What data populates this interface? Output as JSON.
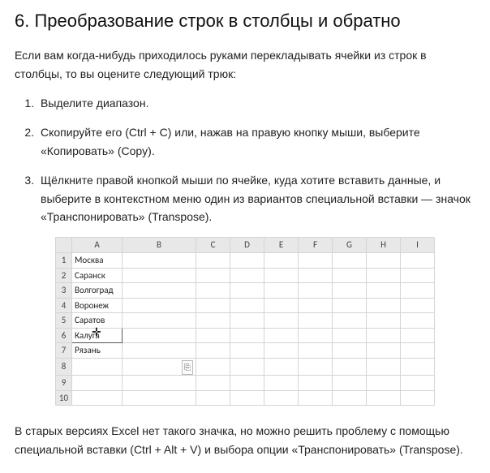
{
  "heading": "6. Преобразование строк в столбцы и обратно",
  "intro": "Если вам когда-нибудь приходилось руками перекладывать ячейки из строк в столбцы, то вы оцените следующий трюк:",
  "steps": {
    "s1": "Выделите диапазон.",
    "s2": "Скопируйте его (Ctrl + C) или, нажав на правую кнопку мыши, выберите «Копировать» (Copy).",
    "s3": "Щёлкните правой кнопкой мыши по ячейке, куда хотите вставить данные, и выберите в контекстном меню один из вариантов специальной вставки — значок «Транспонировать» (Transpose)."
  },
  "excel": {
    "cols": [
      "A",
      "B",
      "C",
      "D",
      "E",
      "F",
      "G",
      "H",
      "I"
    ],
    "rows": [
      {
        "n": "1",
        "a": "Москва"
      },
      {
        "n": "2",
        "a": "Саранск"
      },
      {
        "n": "3",
        "a": "Волгоград"
      },
      {
        "n": "4",
        "a": "Воронеж"
      },
      {
        "n": "5",
        "a": "Саратов"
      },
      {
        "n": "6",
        "a": "Калуга"
      },
      {
        "n": "7",
        "a": "Рязань"
      },
      {
        "n": "8",
        "a": ""
      },
      {
        "n": "9",
        "a": ""
      },
      {
        "n": "10",
        "a": ""
      }
    ],
    "paste_icon": "⎘"
  },
  "outro": "В старых версиях Excel нет такого значка, но можно решить проблему с помощью специальной вставки (Ctrl + Alt + V) и выбора опции «Транспонировать» (Transpose)."
}
